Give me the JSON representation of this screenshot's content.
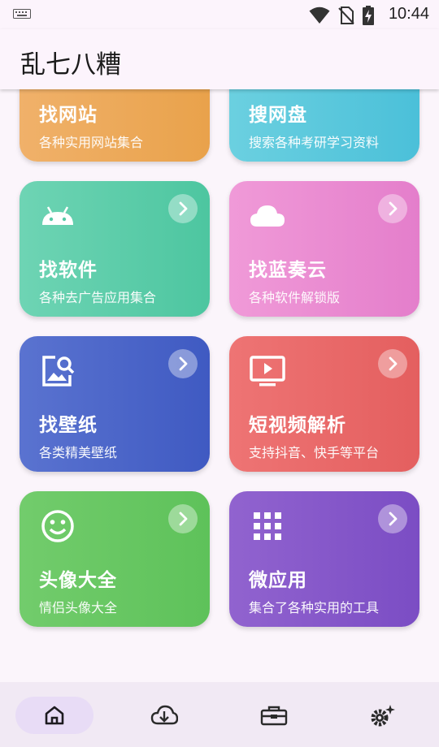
{
  "status": {
    "time": "10:44"
  },
  "app": {
    "title": "乱七八糟"
  },
  "cards": [
    {
      "title": "找网站",
      "subtitle": "各种实用网站集合",
      "icon": "internet-explorer-icon",
      "color_start": "#f0b16a",
      "color_end": "#e9a24b"
    },
    {
      "title": "搜网盘",
      "subtitle": "搜索各种考研学习资料",
      "icon": "hard-drive-icon",
      "color_start": "#6bd0e0",
      "color_end": "#4bc0d9"
    },
    {
      "title": "找软件",
      "subtitle": "各种去广告应用集合",
      "icon": "android-icon",
      "color_start": "#6ed4b4",
      "color_end": "#4dc6a0"
    },
    {
      "title": "找蓝奏云",
      "subtitle": "各种软件解锁版",
      "icon": "cloud-icon",
      "color_start": "#f09ad8",
      "color_end": "#e47ecb"
    },
    {
      "title": "找壁纸",
      "subtitle": "各类精美壁纸",
      "icon": "image-search-icon",
      "color_start": "#5a73d0",
      "color_end": "#3f5ac2"
    },
    {
      "title": "短视频解析",
      "subtitle": "支持抖音、快手等平台",
      "icon": "video-play-icon",
      "color_start": "#ee7474",
      "color_end": "#e45f5f"
    },
    {
      "title": "头像大全",
      "subtitle": "情侣头像大全",
      "icon": "smiley-icon",
      "color_start": "#72cc6c",
      "color_end": "#5ec25a"
    },
    {
      "title": "微应用",
      "subtitle": "集合了各种实用的工具",
      "icon": "apps-grid-icon",
      "color_start": "#9163cf",
      "color_end": "#7b4dc4"
    }
  ],
  "nav": [
    {
      "icon": "home-icon",
      "active": true
    },
    {
      "icon": "cloud-download-icon",
      "active": false
    },
    {
      "icon": "toolbox-icon",
      "active": false
    },
    {
      "icon": "settings-icon",
      "active": false
    }
  ]
}
